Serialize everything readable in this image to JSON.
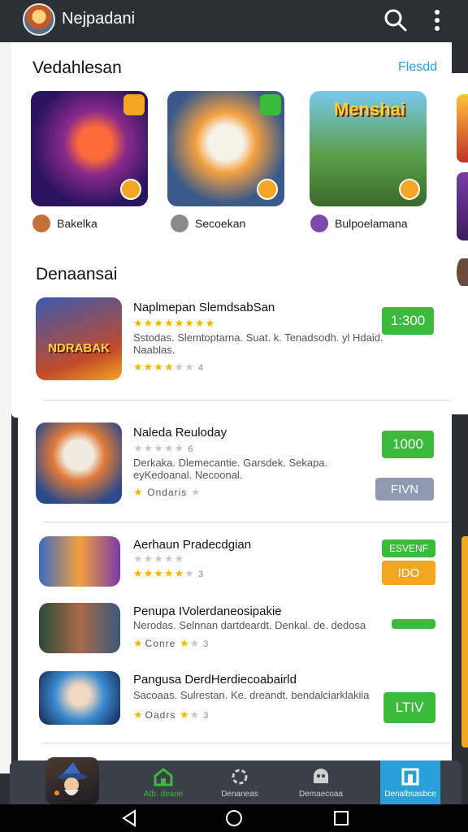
{
  "app": {
    "title": "Nejpadani"
  },
  "featured": {
    "title": "Vedahlesan",
    "see_all": "Flesdd",
    "items": [
      {
        "developer": "Bakelka",
        "banner": ""
      },
      {
        "developer": "Secoekan",
        "banner": ""
      },
      {
        "developer": "Bulpoelamana",
        "banner": "Menshai"
      }
    ]
  },
  "list": {
    "title": "Denaansai",
    "items": [
      {
        "title": "Naplmepan SlemdsabSan",
        "desc": "Sstodas. Slemtoptarna. Suat. k. Tenadsodh. yl Hdaid. Naablas.",
        "rating_filled": 4,
        "rating_count": "4",
        "price": "1:300",
        "icon_text": "NDRABAK"
      },
      {
        "title": "Naleda Reuloday",
        "desc": "Derkaka. Dlemecantie. Garsdek. Sekapa. eyKedoanal. Necoonal.",
        "rating_filled": 1,
        "rating_count": "6",
        "price": "1000",
        "secondary": "FIVN",
        "footer": "Ondaris"
      },
      {
        "title": "Aerhaun Pradecdgian",
        "desc": "",
        "rating_filled": 5,
        "rating_count": "3",
        "price": "ESVENF",
        "secondary": "IDO"
      },
      {
        "title": "Penupa IVolerdaneosipakie",
        "desc": "Nerodas. Selnnan dartdeardt. Denkal. de. dedosa",
        "rating_filled": 1,
        "rating_count": "3",
        "footer": "Conre"
      },
      {
        "title": "Pangusa DerdHerdiecoabairld",
        "desc": "Sacoaas. Sulrestan. Ke. dreandt. bendalciarklakiia",
        "rating_filled": 1,
        "rating_count": "3",
        "price": "LTIV",
        "footer": "Oadrs"
      }
    ]
  },
  "nav": {
    "items": [
      {
        "label": "Atb. deane"
      },
      {
        "label": "Denaneas"
      },
      {
        "label": "Demaecoaa"
      },
      {
        "label": "Denalbsasbce"
      }
    ]
  },
  "colors": {
    "accent_green": "#3cba3c",
    "accent_blue": "#2aa0d8",
    "orange": "#f4a623",
    "grey_button": "#8d9ab0"
  }
}
